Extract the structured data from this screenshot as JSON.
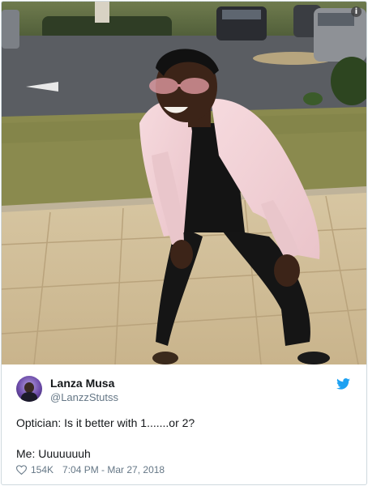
{
  "tweet": {
    "display_name": "Lanza Musa",
    "handle": "@LanzzStutss",
    "text_line1": "Optician: Is it better with 1.......or 2?",
    "text_line2": "Me: Uuuuuuuh",
    "likes": "154K",
    "timestamp": "7:04 PM - Mar 27, 2018"
  },
  "icons": {
    "info": "info-icon",
    "bird": "twitter-bird-icon",
    "heart": "heart-icon"
  },
  "colors": {
    "twitter_blue": "#1da1f2",
    "secondary_text": "#657786",
    "primary_text": "#14171a"
  }
}
